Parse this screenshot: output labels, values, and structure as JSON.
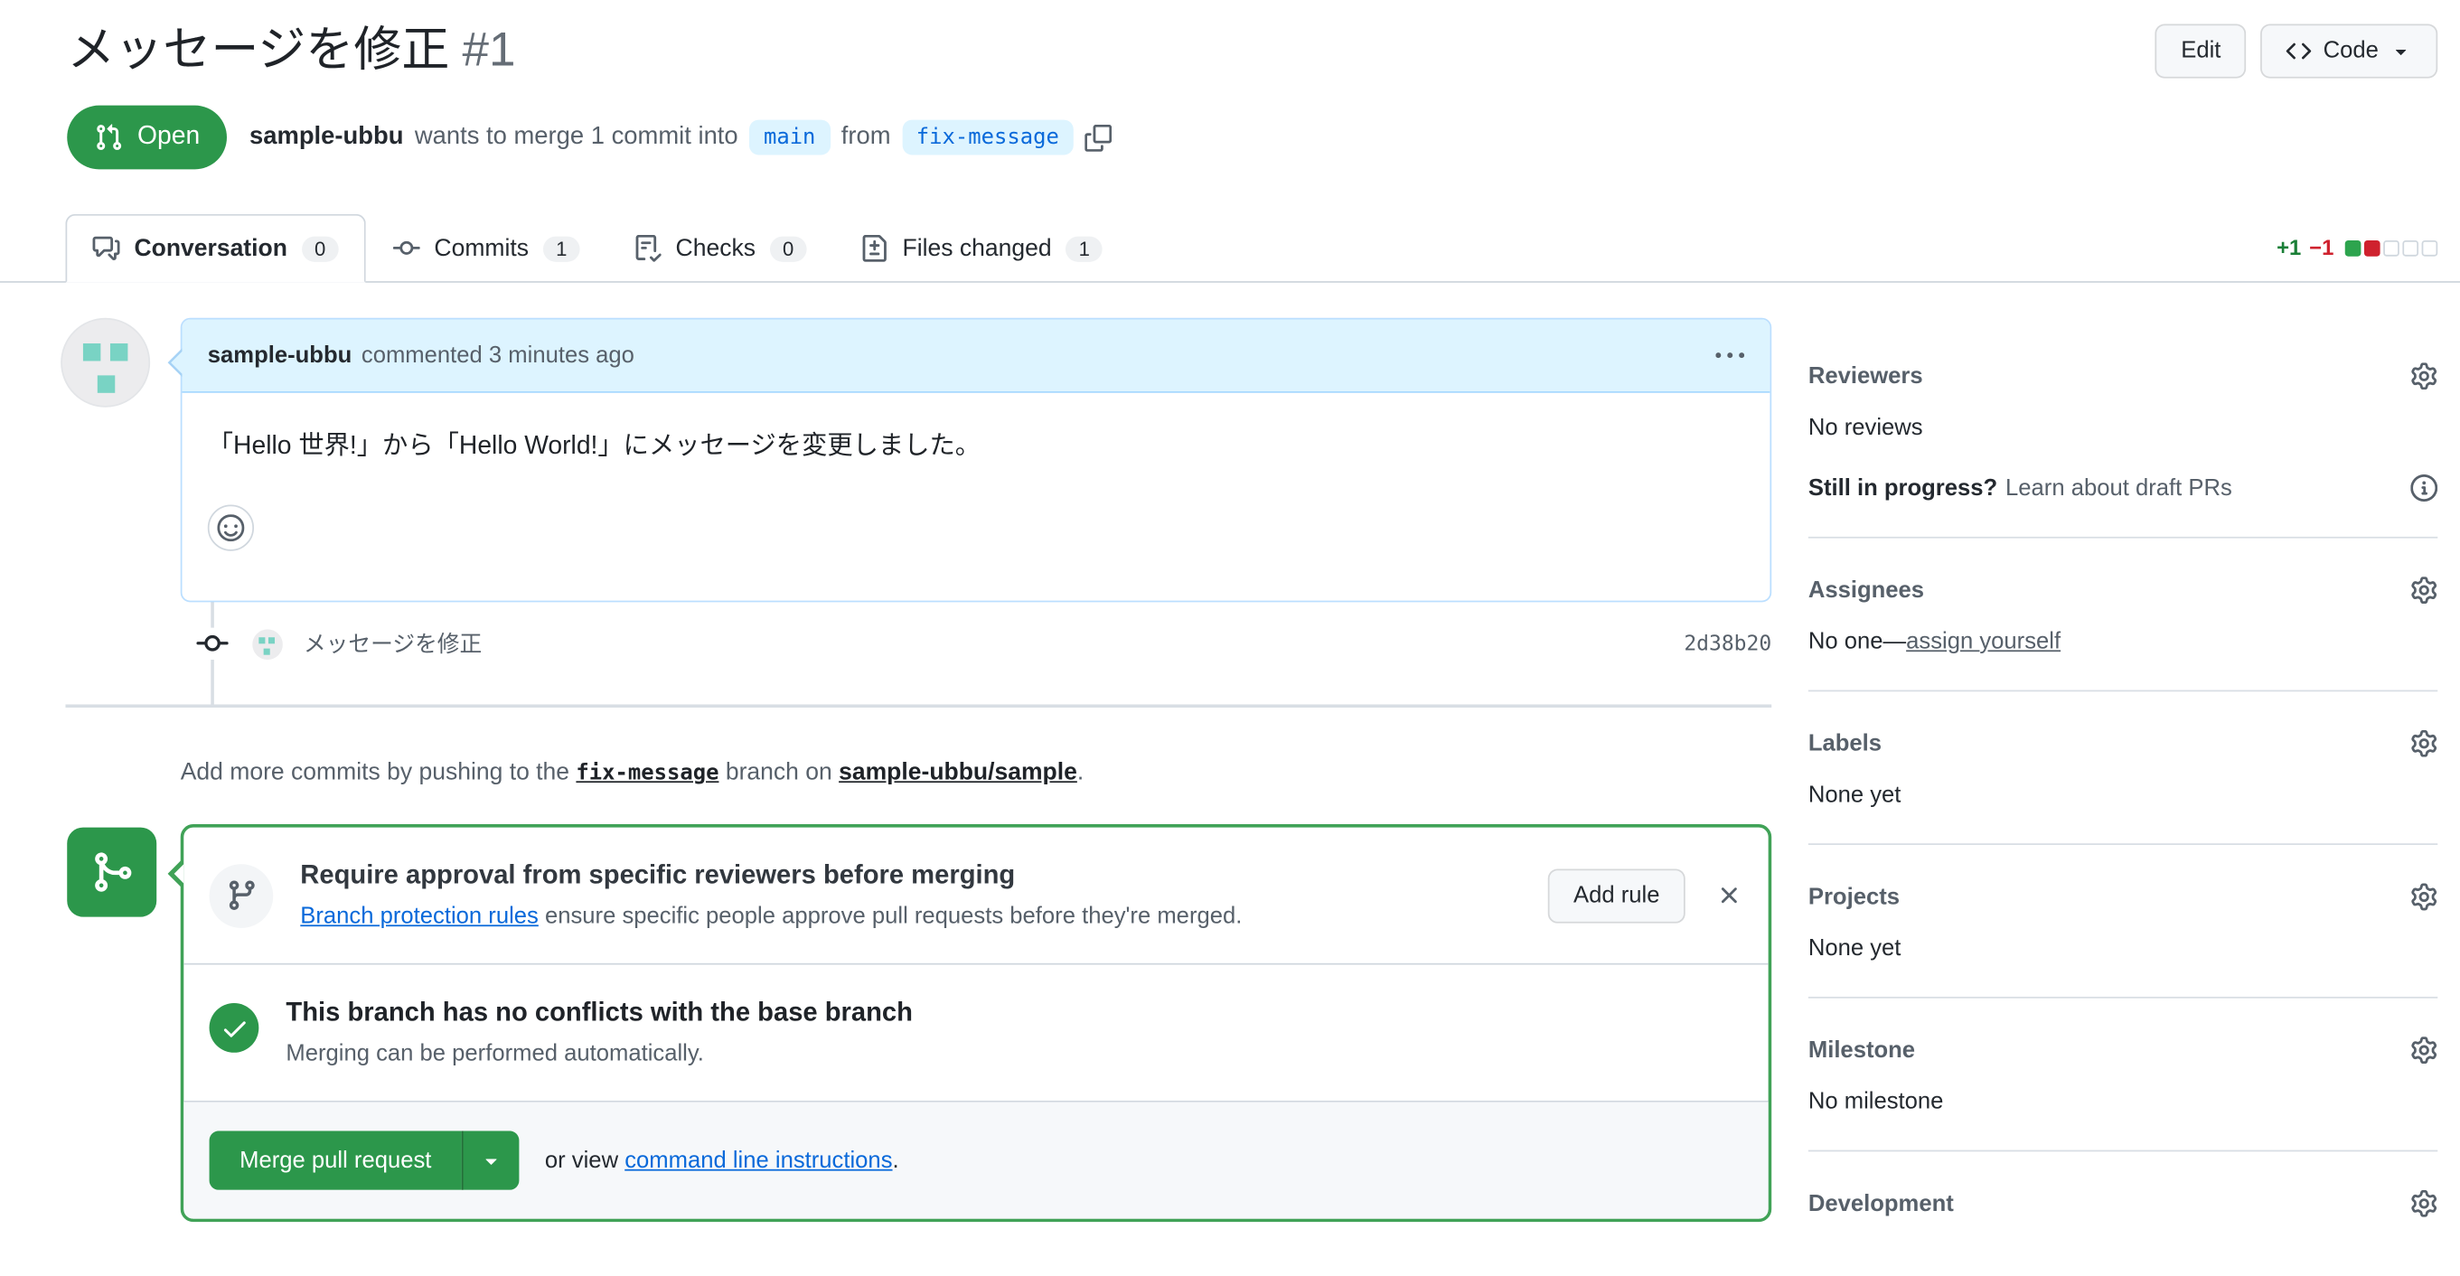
{
  "window": {
    "title_jp": "メッセージを修正",
    "number": "#1"
  },
  "header_actions": {
    "edit": "Edit",
    "code": "Code"
  },
  "pr_meta": {
    "state": "Open",
    "author": "sample-ubbu",
    "text_before_base": "wants to merge 1 commit into",
    "base_branch": "main",
    "text_before_head": "from",
    "head_branch": "fix-message"
  },
  "tabs": [
    {
      "label": "Conversation",
      "count": "0"
    },
    {
      "label": "Commits",
      "count": "1"
    },
    {
      "label": "Checks",
      "count": "0"
    },
    {
      "label": "Files changed",
      "count": "1"
    }
  ],
  "diffstat": {
    "additions": "+1",
    "deletions": "−1"
  },
  "comment": {
    "author": "sample-ubbu",
    "meta": "commented 3 minutes ago",
    "body": "「Hello 世界!」から「Hello World!」にメッセージを変更しました。"
  },
  "commit": {
    "message": "メッセージを修正",
    "sha": "2d38b20"
  },
  "push_note": {
    "before": "Add more commits by pushing to the",
    "branch": "fix-message",
    "middle": "branch on",
    "repo": "sample-ubbu/sample",
    "after": "."
  },
  "merge_box": {
    "protection_title": "Require approval from specific reviewers before merging",
    "protection_link": "Branch protection rules",
    "protection_rest": "ensure specific people approve pull requests before they're merged.",
    "add_rule": "Add rule",
    "conflict_title": "This branch has no conflicts with the base branch",
    "conflict_sub": "Merging can be performed automatically.",
    "merge_button": "Merge pull request",
    "or_view": "or view",
    "cli_link": "command line instructions",
    "after_link": "."
  },
  "sidebar": {
    "reviewers": {
      "heading": "Reviewers",
      "empty": "No reviews",
      "draft_q": "Still in progress?",
      "draft_link": "Learn about draft PRs"
    },
    "assignees": {
      "heading": "Assignees",
      "empty": "No one—",
      "self_link": "assign yourself"
    },
    "labels": {
      "heading": "Labels",
      "empty": "None yet"
    },
    "projects": {
      "heading": "Projects",
      "empty": "None yet"
    },
    "milestone": {
      "heading": "Milestone",
      "empty": "No milestone"
    },
    "development": {
      "heading": "Development"
    }
  },
  "colors": {
    "open_green": "#2c974b",
    "merge_box_border_green": "#40a257",
    "link_blue": "#0969da",
    "branch_label_bg": "#ddf4ff",
    "comment_header_bg": "#ddf4ff",
    "added_green": "#2da44e",
    "deleted_red": "#cf222e",
    "muted_gray": "#57606a",
    "identicon_teal": "#79d3c4"
  },
  "icons": {
    "git-pull-request-icon": "svg",
    "comment-discussion-icon": "svg",
    "git-commit-icon": "svg",
    "checklist-icon": "svg",
    "file-diff-icon": "svg",
    "copy-icon": "svg",
    "kebab-icon": "svg",
    "smiley-icon": "svg",
    "git-merge-icon": "svg",
    "git-branch-icon": "svg",
    "check-icon": "svg",
    "x-icon": "svg",
    "gear-icon": "svg",
    "info-icon": "svg",
    "code-icon": "svg",
    "triangle-down-icon": "svg",
    "identicon": "teal-squares"
  }
}
